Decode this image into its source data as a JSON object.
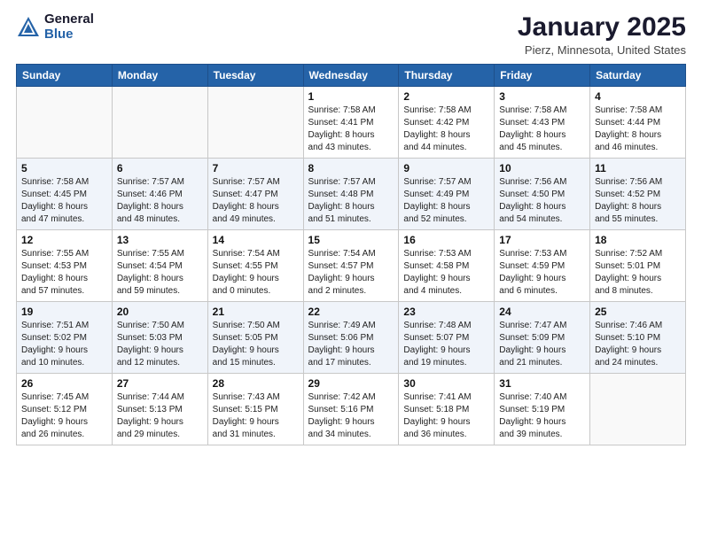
{
  "header": {
    "logo_general": "General",
    "logo_blue": "Blue",
    "month_title": "January 2025",
    "location": "Pierz, Minnesota, United States"
  },
  "days_of_week": [
    "Sunday",
    "Monday",
    "Tuesday",
    "Wednesday",
    "Thursday",
    "Friday",
    "Saturday"
  ],
  "weeks": [
    [
      {
        "day": "",
        "info": ""
      },
      {
        "day": "",
        "info": ""
      },
      {
        "day": "",
        "info": ""
      },
      {
        "day": "1",
        "info": "Sunrise: 7:58 AM\nSunset: 4:41 PM\nDaylight: 8 hours\nand 43 minutes."
      },
      {
        "day": "2",
        "info": "Sunrise: 7:58 AM\nSunset: 4:42 PM\nDaylight: 8 hours\nand 44 minutes."
      },
      {
        "day": "3",
        "info": "Sunrise: 7:58 AM\nSunset: 4:43 PM\nDaylight: 8 hours\nand 45 minutes."
      },
      {
        "day": "4",
        "info": "Sunrise: 7:58 AM\nSunset: 4:44 PM\nDaylight: 8 hours\nand 46 minutes."
      }
    ],
    [
      {
        "day": "5",
        "info": "Sunrise: 7:58 AM\nSunset: 4:45 PM\nDaylight: 8 hours\nand 47 minutes."
      },
      {
        "day": "6",
        "info": "Sunrise: 7:57 AM\nSunset: 4:46 PM\nDaylight: 8 hours\nand 48 minutes."
      },
      {
        "day": "7",
        "info": "Sunrise: 7:57 AM\nSunset: 4:47 PM\nDaylight: 8 hours\nand 49 minutes."
      },
      {
        "day": "8",
        "info": "Sunrise: 7:57 AM\nSunset: 4:48 PM\nDaylight: 8 hours\nand 51 minutes."
      },
      {
        "day": "9",
        "info": "Sunrise: 7:57 AM\nSunset: 4:49 PM\nDaylight: 8 hours\nand 52 minutes."
      },
      {
        "day": "10",
        "info": "Sunrise: 7:56 AM\nSunset: 4:50 PM\nDaylight: 8 hours\nand 54 minutes."
      },
      {
        "day": "11",
        "info": "Sunrise: 7:56 AM\nSunset: 4:52 PM\nDaylight: 8 hours\nand 55 minutes."
      }
    ],
    [
      {
        "day": "12",
        "info": "Sunrise: 7:55 AM\nSunset: 4:53 PM\nDaylight: 8 hours\nand 57 minutes."
      },
      {
        "day": "13",
        "info": "Sunrise: 7:55 AM\nSunset: 4:54 PM\nDaylight: 8 hours\nand 59 minutes."
      },
      {
        "day": "14",
        "info": "Sunrise: 7:54 AM\nSunset: 4:55 PM\nDaylight: 9 hours\nand 0 minutes."
      },
      {
        "day": "15",
        "info": "Sunrise: 7:54 AM\nSunset: 4:57 PM\nDaylight: 9 hours\nand 2 minutes."
      },
      {
        "day": "16",
        "info": "Sunrise: 7:53 AM\nSunset: 4:58 PM\nDaylight: 9 hours\nand 4 minutes."
      },
      {
        "day": "17",
        "info": "Sunrise: 7:53 AM\nSunset: 4:59 PM\nDaylight: 9 hours\nand 6 minutes."
      },
      {
        "day": "18",
        "info": "Sunrise: 7:52 AM\nSunset: 5:01 PM\nDaylight: 9 hours\nand 8 minutes."
      }
    ],
    [
      {
        "day": "19",
        "info": "Sunrise: 7:51 AM\nSunset: 5:02 PM\nDaylight: 9 hours\nand 10 minutes."
      },
      {
        "day": "20",
        "info": "Sunrise: 7:50 AM\nSunset: 5:03 PM\nDaylight: 9 hours\nand 12 minutes."
      },
      {
        "day": "21",
        "info": "Sunrise: 7:50 AM\nSunset: 5:05 PM\nDaylight: 9 hours\nand 15 minutes."
      },
      {
        "day": "22",
        "info": "Sunrise: 7:49 AM\nSunset: 5:06 PM\nDaylight: 9 hours\nand 17 minutes."
      },
      {
        "day": "23",
        "info": "Sunrise: 7:48 AM\nSunset: 5:07 PM\nDaylight: 9 hours\nand 19 minutes."
      },
      {
        "day": "24",
        "info": "Sunrise: 7:47 AM\nSunset: 5:09 PM\nDaylight: 9 hours\nand 21 minutes."
      },
      {
        "day": "25",
        "info": "Sunrise: 7:46 AM\nSunset: 5:10 PM\nDaylight: 9 hours\nand 24 minutes."
      }
    ],
    [
      {
        "day": "26",
        "info": "Sunrise: 7:45 AM\nSunset: 5:12 PM\nDaylight: 9 hours\nand 26 minutes."
      },
      {
        "day": "27",
        "info": "Sunrise: 7:44 AM\nSunset: 5:13 PM\nDaylight: 9 hours\nand 29 minutes."
      },
      {
        "day": "28",
        "info": "Sunrise: 7:43 AM\nSunset: 5:15 PM\nDaylight: 9 hours\nand 31 minutes."
      },
      {
        "day": "29",
        "info": "Sunrise: 7:42 AM\nSunset: 5:16 PM\nDaylight: 9 hours\nand 34 minutes."
      },
      {
        "day": "30",
        "info": "Sunrise: 7:41 AM\nSunset: 5:18 PM\nDaylight: 9 hours\nand 36 minutes."
      },
      {
        "day": "31",
        "info": "Sunrise: 7:40 AM\nSunset: 5:19 PM\nDaylight: 9 hours\nand 39 minutes."
      },
      {
        "day": "",
        "info": ""
      }
    ]
  ]
}
